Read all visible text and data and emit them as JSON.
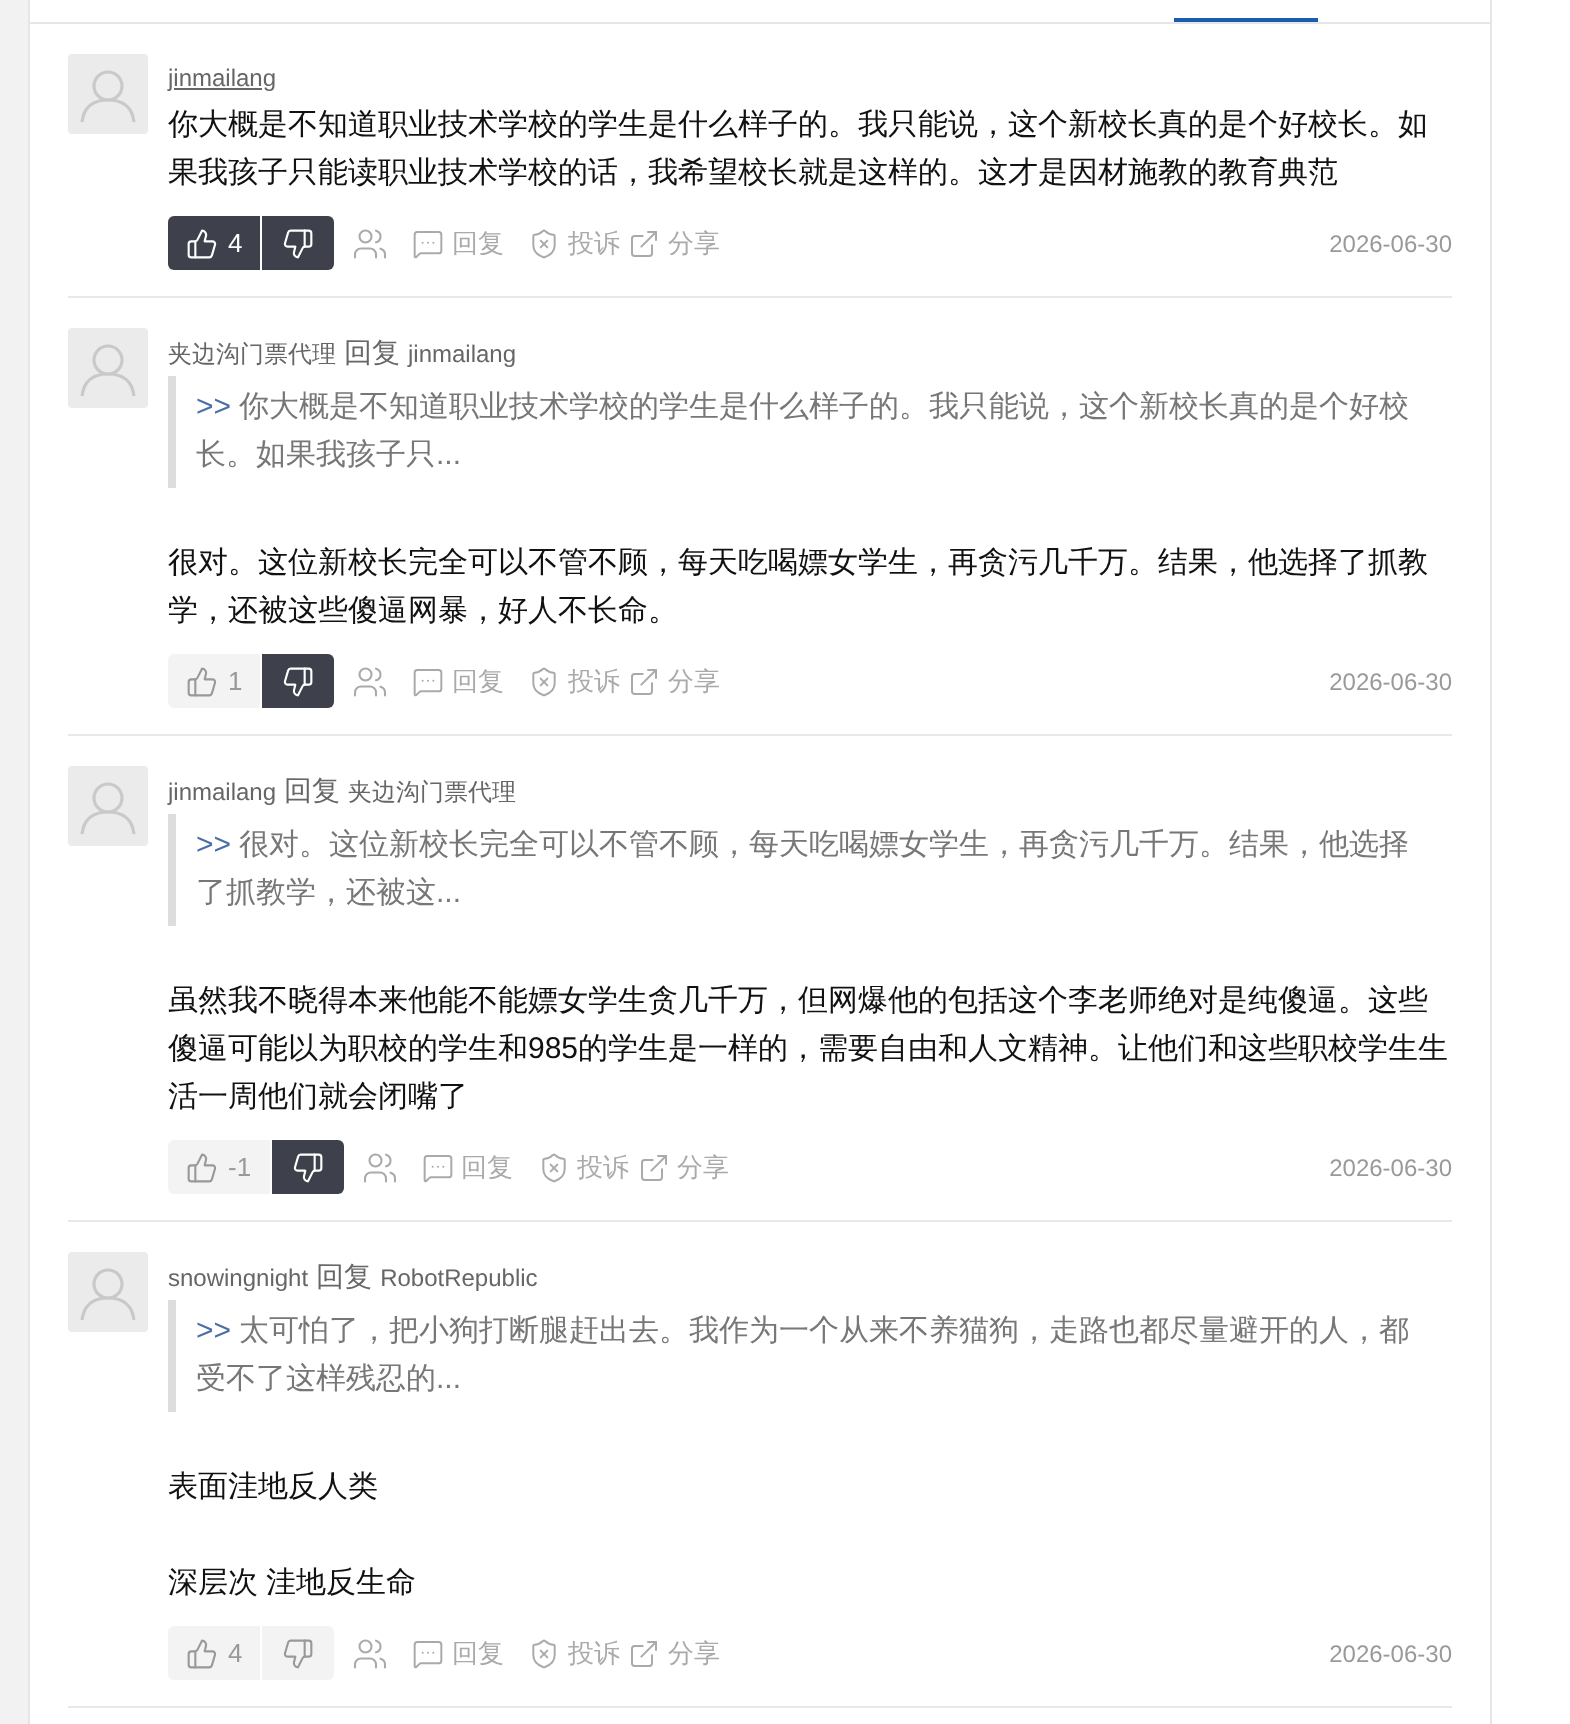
{
  "tabs": [
    {
      "selected": true
    },
    {
      "selected": false
    }
  ],
  "comments": [
    {
      "author": "jinmailang",
      "author_underlined": true,
      "paragraphs": [
        "你大概是不知道职业技术学校的学生是什么样子的。我只能说，这个新校长真的是个好校长。如果我孩子只能读职业技术学校的话，我希望校长就是这样的。这才是因材施教的教育典范"
      ],
      "likes": "4",
      "liked": true,
      "disliked": true,
      "actions": [
        {
          "kind": "reply",
          "label": "回复"
        },
        {
          "kind": "report",
          "label": "投诉"
        },
        {
          "kind": "share",
          "label": "分享"
        }
      ],
      "date": "2026-06-30"
    },
    {
      "author": "夹边沟门票代理",
      "author_underlined": false,
      "reply_label": "回复",
      "reply_to": "jinmailang",
      "quote": {
        "marker": ">>",
        "text": "你大概是不知道职业技术学校的学生是什么样子的。我只能说，这个新校长真的是个好校长。如果我孩子只..."
      },
      "paragraphs": [
        "很对。这位新校长完全可以不管不顾，每天吃喝嫖女学生，再贪污几千万。结果，他选择了抓教学，还被这些傻逼网暴，好人不长命。"
      ],
      "likes": "1",
      "liked": false,
      "disliked": true,
      "actions": [
        {
          "kind": "reply",
          "label": "回复"
        },
        {
          "kind": "report",
          "label": "投诉"
        },
        {
          "kind": "share",
          "label": "分享"
        }
      ],
      "date": "2026-06-30"
    },
    {
      "author": "jinmailang",
      "author_underlined": false,
      "reply_label": "回复",
      "reply_to": "夹边沟门票代理",
      "quote": {
        "marker": ">>",
        "text": "很对。这位新校长完全可以不管不顾，每天吃喝嫖女学生，再贪污几千万。结果，他选择了抓教学，还被这..."
      },
      "paragraphs": [
        "虽然我不晓得本来他能不能嫖女学生贪几千万，但网爆他的包括这个李老师绝对是纯傻逼。这些傻逼可能以为职校的学生和985的学生是一样的，需要自由和人文精神。让他们和这些职校学生生活一周他们就会闭嘴了"
      ],
      "likes": "-1",
      "liked": false,
      "disliked": true,
      "actions": [
        {
          "kind": "reply",
          "label": "回复"
        },
        {
          "kind": "report",
          "label": "投诉"
        },
        {
          "kind": "share",
          "label": "分享"
        }
      ],
      "date": "2026-06-30"
    },
    {
      "author": "snowingnight",
      "author_underlined": false,
      "reply_label": "回复",
      "reply_to": "RobotRepublic",
      "quote": {
        "marker": ">>",
        "text": "太可怕了，把小狗打断腿赶出去。我作为一个从来不养猫狗，走路也都尽量避开的人，都受不了这样残忍的..."
      },
      "paragraphs": [
        "表面洼地反人类",
        "深层次 洼地反生命"
      ],
      "likes": "4",
      "liked": false,
      "disliked": false,
      "actions": [
        {
          "kind": "reply",
          "label": "回复"
        },
        {
          "kind": "report",
          "label": "投诉"
        },
        {
          "kind": "share",
          "label": "分享"
        }
      ],
      "date": "2026-06-30"
    }
  ]
}
